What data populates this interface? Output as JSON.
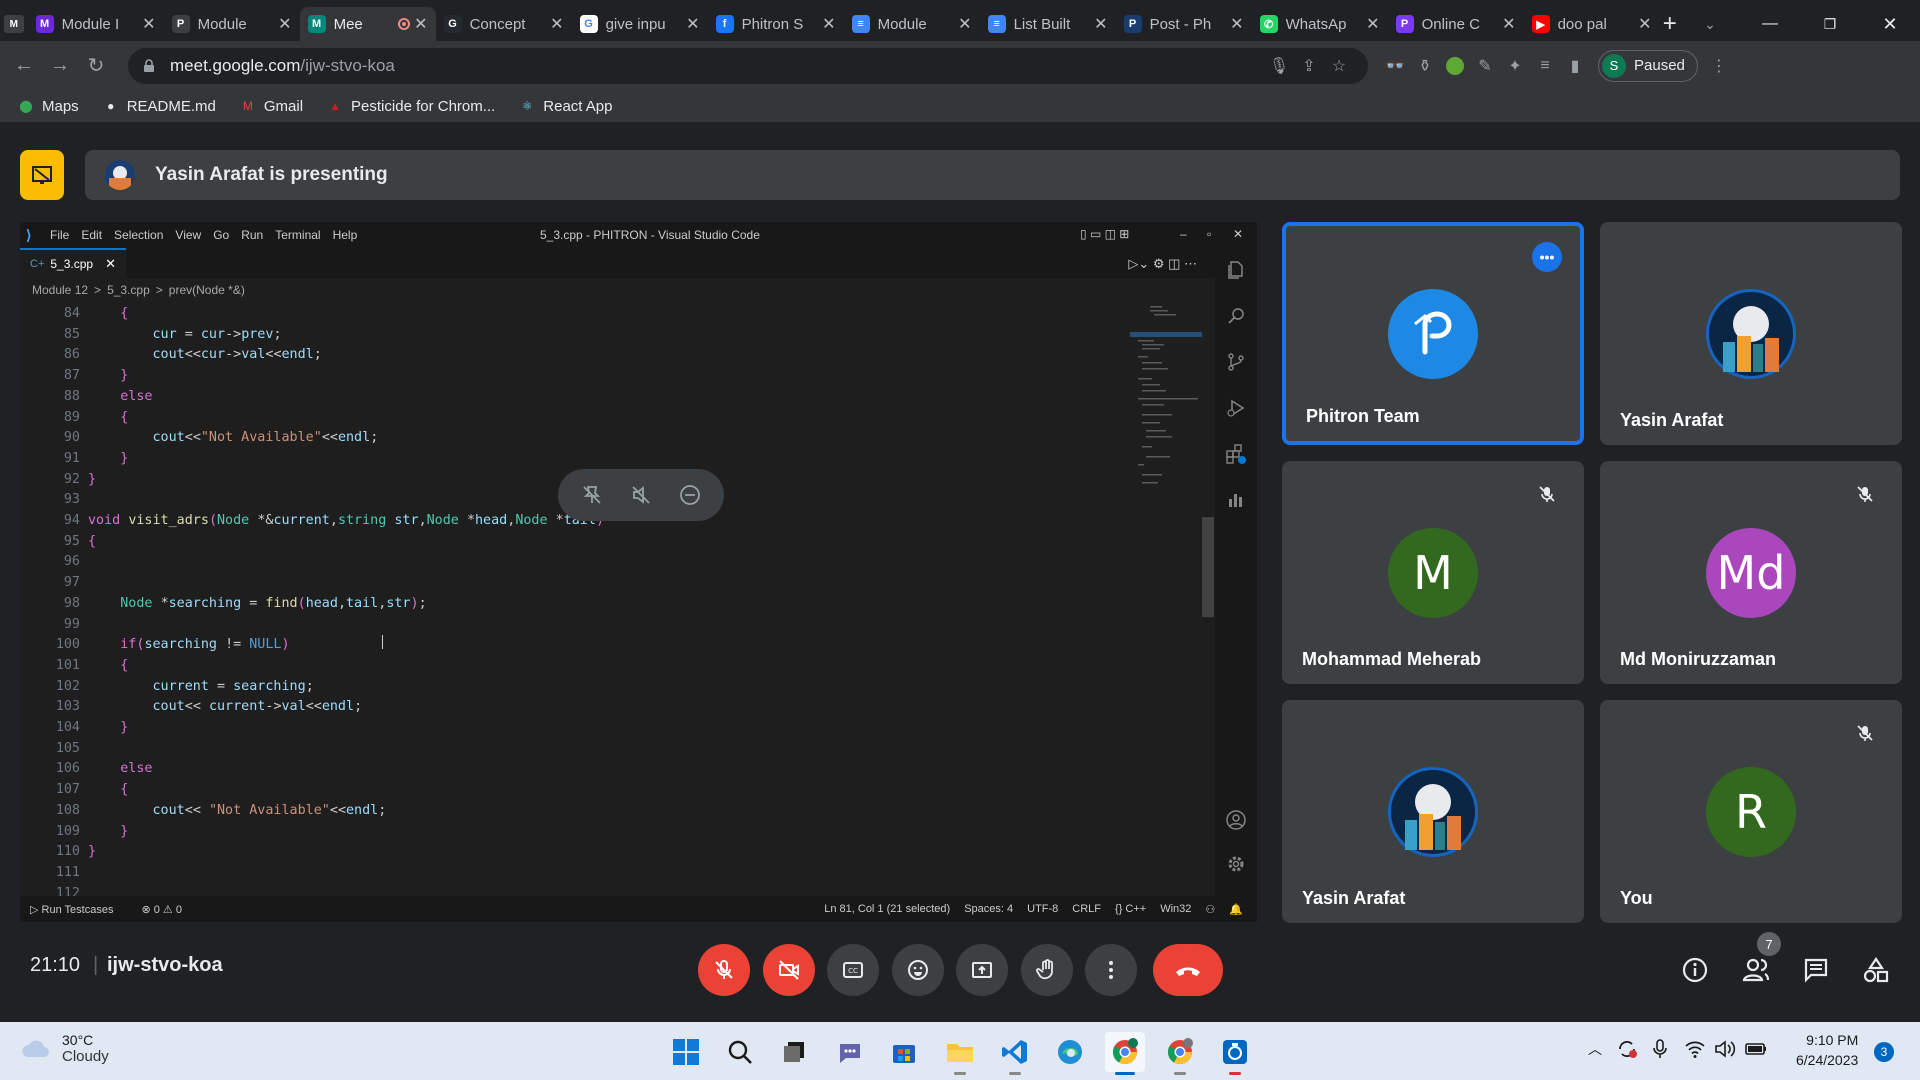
{
  "browser": {
    "tabs": [
      {
        "title": "Module I",
        "favicon_color": "#6d28d9",
        "favicon_text": "M"
      },
      {
        "title": "Module",
        "favicon_color": "#3c4043",
        "favicon_text": "P"
      },
      {
        "title": "Mee",
        "favicon_color": "#00897b",
        "favicon_text": "M",
        "active": true,
        "recording": true
      },
      {
        "title": "Concept",
        "favicon_color": "#24292f",
        "favicon_text": "G"
      },
      {
        "title": "give inpu",
        "favicon_color": "#ffffff",
        "favicon_text": "G"
      },
      {
        "title": "Phitron S",
        "favicon_color": "#1877f2",
        "favicon_text": "f"
      },
      {
        "title": "Module",
        "favicon_color": "#4285f4",
        "favicon_text": "≡"
      },
      {
        "title": "List Built",
        "favicon_color": "#4285f4",
        "favicon_text": "≡"
      },
      {
        "title": "Post - Ph",
        "favicon_color": "#1a3c6e",
        "favicon_text": "P"
      },
      {
        "title": "WhatsAp",
        "favicon_color": "#25d366",
        "favicon_text": "✆"
      },
      {
        "title": "Online C",
        "favicon_color": "#7c3aed",
        "favicon_text": "P"
      },
      {
        "title": "doo pal",
        "favicon_color": "#ff0000",
        "favicon_text": "▶"
      }
    ],
    "url_host": "meet.google.com",
    "url_path": "/ijw-stvo-koa",
    "profile_initial": "S",
    "profile_status": "Paused",
    "bookmarks": [
      {
        "label": "Maps",
        "icon": "maps-pin-icon"
      },
      {
        "label": "README.md",
        "icon": "github-icon"
      },
      {
        "label": "Gmail",
        "icon": "gmail-icon"
      },
      {
        "label": "Pesticide for Chrom...",
        "icon": "pesticide-icon"
      },
      {
        "label": "React App",
        "icon": "react-icon"
      }
    ]
  },
  "meet": {
    "presenting_text": "Yasin Arafat is presenting",
    "time": "21:10",
    "meeting_code": "ijw-stvo-koa",
    "people_count": "7",
    "participants": [
      {
        "name": "Phitron Team",
        "avatar_type": "logo",
        "avatar_color": "#1e88e5",
        "active": true
      },
      {
        "name": "Yasin Arafat",
        "avatar_type": "image"
      },
      {
        "name": "Mohammad Meherab",
        "avatar_type": "letter",
        "initials": "M",
        "avatar_color": "#33691e",
        "muted": true
      },
      {
        "name": "Md Moniruzzaman",
        "avatar_type": "letter",
        "initials": "Md",
        "avatar_color": "#ab47bc",
        "muted": true
      },
      {
        "name": "Yasin Arafat",
        "avatar_type": "image"
      },
      {
        "name": "You",
        "avatar_type": "letter",
        "initials": "R",
        "avatar_color": "#33691e",
        "muted": true
      }
    ]
  },
  "vscode": {
    "menu": [
      "File",
      "Edit",
      "Selection",
      "View",
      "Go",
      "Run",
      "Terminal",
      "Help"
    ],
    "window_title": "5_3.cpp - PHITRON - Visual Studio Code",
    "tab_label": "5_3.cpp",
    "breadcrumb": [
      "Module 12",
      ">",
      "5_3.cpp",
      ">",
      "prev(Node *&)"
    ],
    "lines": [
      {
        "n": "84",
        "t": "    {"
      },
      {
        "n": "85",
        "t": "        cur = cur->prev;"
      },
      {
        "n": "86",
        "t": "        cout<<cur->val<<endl;"
      },
      {
        "n": "87",
        "t": "    }"
      },
      {
        "n": "88",
        "t": "    else"
      },
      {
        "n": "89",
        "t": "    {"
      },
      {
        "n": "90",
        "t": "        cout<<\"Not Available\"<<endl;"
      },
      {
        "n": "91",
        "t": "    }"
      },
      {
        "n": "92",
        "t": "}"
      },
      {
        "n": "93",
        "t": ""
      },
      {
        "n": "94",
        "t": "void visit_adrs(Node *&current,string str,Node *head,Node *tail)"
      },
      {
        "n": "95",
        "t": "{"
      },
      {
        "n": "96",
        "t": ""
      },
      {
        "n": "97",
        "t": ""
      },
      {
        "n": "98",
        "t": "    Node *searching = find(head,tail,str);"
      },
      {
        "n": "99",
        "t": ""
      },
      {
        "n": "100",
        "t": "    if(searching != NULL)"
      },
      {
        "n": "101",
        "t": "    {"
      },
      {
        "n": "102",
        "t": "        current = searching;"
      },
      {
        "n": "103",
        "t": "        cout<< current->val<<endl;"
      },
      {
        "n": "104",
        "t": "    }"
      },
      {
        "n": "105",
        "t": ""
      },
      {
        "n": "106",
        "t": "    else"
      },
      {
        "n": "107",
        "t": "    {"
      },
      {
        "n": "108",
        "t": "        cout<< \"Not Available\"<<endl;"
      },
      {
        "n": "109",
        "t": "    }"
      },
      {
        "n": "110",
        "t": "}"
      },
      {
        "n": "111",
        "t": ""
      },
      {
        "n": "112",
        "t": ""
      }
    ],
    "status": {
      "run_testcases": "Run Testcases",
      "problems": "⊗ 0 ⚠ 0",
      "position": "Ln 81, Col 1 (21 selected)",
      "spaces": "Spaces: 4",
      "encoding": "UTF-8",
      "eol": "CRLF",
      "language": "{} C++",
      "platform": "Win32"
    }
  },
  "taskbar": {
    "temperature": "30°C",
    "condition": "Cloudy",
    "time": "9:10 PM",
    "date": "6/24/2023",
    "notification_count": "3"
  }
}
